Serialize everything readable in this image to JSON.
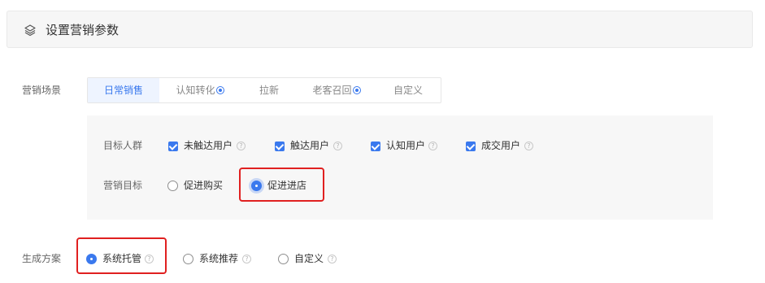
{
  "header": {
    "title": "设置营销参数",
    "icon": "layers-icon"
  },
  "scene": {
    "label": "营销场景",
    "tabs": [
      {
        "label": "日常销售",
        "active": true,
        "badge": false
      },
      {
        "label": "认知转化",
        "active": false,
        "badge": true
      },
      {
        "label": "拉新",
        "active": false,
        "badge": false
      },
      {
        "label": "老客召回",
        "active": false,
        "badge": true
      },
      {
        "label": "自定义",
        "active": false,
        "badge": false
      }
    ]
  },
  "audience": {
    "label": "目标人群",
    "options": [
      {
        "label": "未触达用户",
        "checked": true
      },
      {
        "label": "触达用户",
        "checked": true
      },
      {
        "label": "认知用户",
        "checked": true
      },
      {
        "label": "成交用户",
        "checked": true
      }
    ]
  },
  "goal": {
    "label": "营销目标",
    "options": [
      {
        "label": "促进购买",
        "selected": false
      },
      {
        "label": "促进进店",
        "selected": true
      }
    ]
  },
  "plan": {
    "label": "生成方案",
    "options": [
      {
        "label": "系统托管",
        "selected": true
      },
      {
        "label": "系统推荐",
        "selected": false
      },
      {
        "label": "自定义",
        "selected": false
      }
    ]
  },
  "help_glyph": "?",
  "colors": {
    "accent": "#3a79ee",
    "highlight": "#e02020",
    "panel": "#f7f7f7"
  }
}
